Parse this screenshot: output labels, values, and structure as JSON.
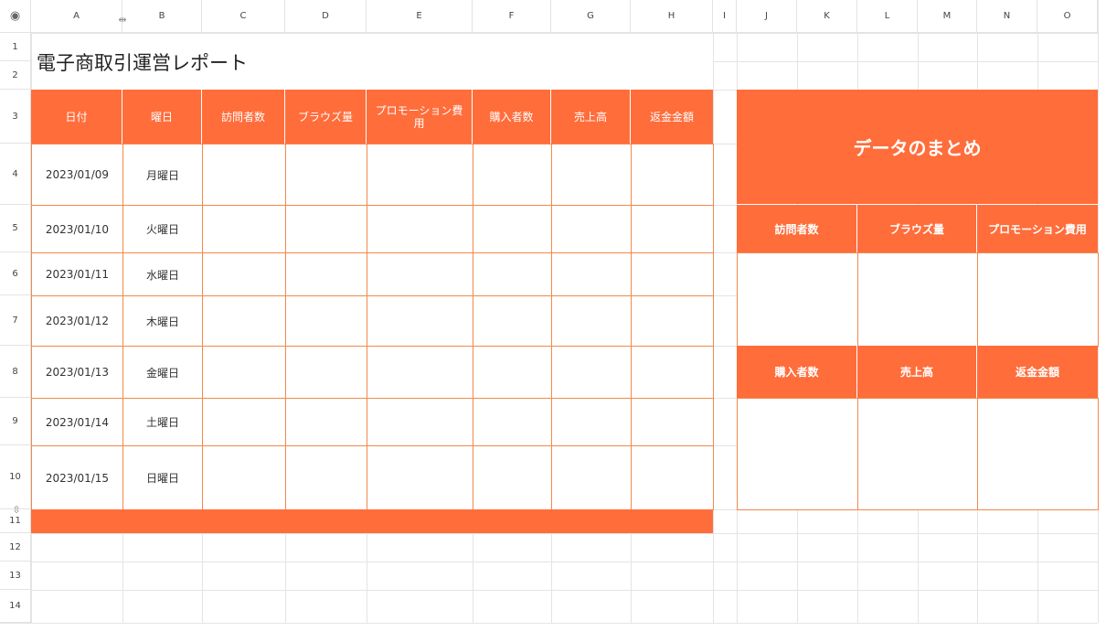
{
  "sheet": {
    "corner_icon": "eye-icon",
    "columns": [
      "A",
      "B",
      "C",
      "D",
      "E",
      "F",
      "G",
      "H",
      "I",
      "J",
      "K",
      "L",
      "M",
      "N",
      "O"
    ],
    "rows": [
      "1",
      "2",
      "3",
      "4",
      "5",
      "6",
      "7",
      "8",
      "9",
      "10",
      "11",
      "12",
      "13",
      "14"
    ]
  },
  "report": {
    "title": "電子商取引運営レポート",
    "headers": [
      "日付",
      "曜日",
      "訪問者数",
      "ブラウズ量",
      "プロモーション費用",
      "購入者数",
      "売上高",
      "返金金額"
    ],
    "rows": [
      {
        "date": "2023/01/09",
        "day": "月曜日"
      },
      {
        "date": "2023/01/10",
        "day": "火曜日"
      },
      {
        "date": "2023/01/11",
        "day": "水曜日"
      },
      {
        "date": "2023/01/12",
        "day": "木曜日"
      },
      {
        "date": "2023/01/13",
        "day": "金曜日"
      },
      {
        "date": "2023/01/14",
        "day": "土曜日"
      },
      {
        "date": "2023/01/15",
        "day": "日曜日"
      }
    ]
  },
  "summary": {
    "title": "データのまとめ",
    "row1_headers": [
      "訪問者数",
      "ブラウズ量",
      "プロモーション費用"
    ],
    "row2_headers": [
      "購入者数",
      "売上高",
      "返金金額"
    ]
  },
  "colors": {
    "accent": "#ff6d3b",
    "border": "#f08a4b",
    "grid": "#e4e4e4"
  }
}
